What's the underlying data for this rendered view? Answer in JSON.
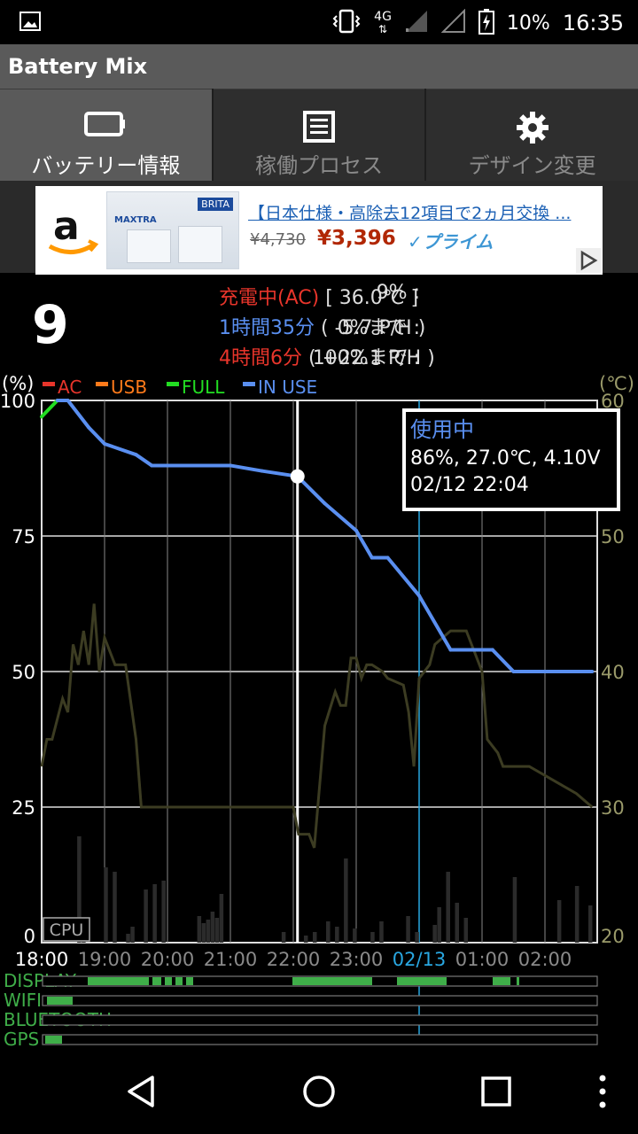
{
  "status_bar": {
    "battery_percent": "10%",
    "time": "16:35",
    "network": "4G",
    "icons": [
      "image-icon",
      "vibrate-icon",
      "signal-icon",
      "battery-charging-icon"
    ]
  },
  "app": {
    "title": "Battery Mix"
  },
  "tabs": [
    {
      "label": "バッテリー情報",
      "icon": "battery-icon",
      "active": true
    },
    {
      "label": "稼働プロセス",
      "icon": "list-icon",
      "active": false
    },
    {
      "label": "デザイン変更",
      "icon": "gear-icon",
      "active": false
    }
  ],
  "ad": {
    "title": "【日本仕様・高除去12項目で2ヵ月交換 ...",
    "price_old": "¥4,730",
    "price": "¥3,396",
    "prime": "✓プライム",
    "product_brand": "BRITA",
    "product_name": "MAXTRA"
  },
  "battery": {
    "level_big": "9",
    "line1": {
      "label": "9% : ",
      "value": "充電中(AC)",
      "extra": " [ 36.0℃ ]"
    },
    "line2": {
      "label": "0%まで : ",
      "value": "1時間35分",
      "extra": " ( -5.7 P/H )"
    },
    "line3": {
      "label": "100%まで : ",
      "value": "4時間6分",
      "extra": " ( +22.1 P/H )"
    }
  },
  "chart_data": {
    "type": "line",
    "left_axis_label": "(%)",
    "right_axis_label": "(℃)",
    "y_ticks_left": [
      "100",
      "75",
      "50",
      "25",
      "0"
    ],
    "y_ticks_right": [
      "60",
      "50",
      "40",
      "30",
      "20"
    ],
    "x_ticks": [
      "18:00",
      "19:00",
      "20:00",
      "21:00",
      "22:00",
      "23:00",
      "02/13",
      "01:00",
      "02:00"
    ],
    "legend": [
      {
        "name": "AC",
        "color": "#e8352b"
      },
      {
        "name": "USB",
        "color": "#ff7a1a"
      },
      {
        "name": "FULL",
        "color": "#22dd22"
      },
      {
        "name": "IN USE",
        "color": "#5a8ff0"
      }
    ],
    "cpu_label": "CPU",
    "tooltip": {
      "title": "使用中",
      "line1": "86%, 27.0℃, 4.10V",
      "line2": "02/12 22:04"
    },
    "battery_series": [
      {
        "t": "18:00",
        "v": 97,
        "state": "AC"
      },
      {
        "t": "18:15",
        "v": 100,
        "state": "FULL"
      },
      {
        "t": "18:25",
        "v": 100,
        "state": "IN USE"
      },
      {
        "t": "18:45",
        "v": 95,
        "state": "IN USE"
      },
      {
        "t": "19:00",
        "v": 92,
        "state": "IN USE"
      },
      {
        "t": "19:30",
        "v": 90,
        "state": "IN USE"
      },
      {
        "t": "19:45",
        "v": 88,
        "state": "IN USE"
      },
      {
        "t": "21:00",
        "v": 88,
        "state": "IN USE"
      },
      {
        "t": "21:30",
        "v": 87,
        "state": "IN USE"
      },
      {
        "t": "22:04",
        "v": 86,
        "state": "IN USE"
      },
      {
        "t": "22:30",
        "v": 81,
        "state": "IN USE"
      },
      {
        "t": "23:00",
        "v": 76,
        "state": "IN USE"
      },
      {
        "t": "23:15",
        "v": 71,
        "state": "IN USE"
      },
      {
        "t": "23:30",
        "v": 71,
        "state": "IN USE"
      },
      {
        "t": "00:00",
        "v": 64,
        "state": "IN USE"
      },
      {
        "t": "00:30",
        "v": 54,
        "state": "IN USE"
      },
      {
        "t": "01:10",
        "v": 54,
        "state": "IN USE"
      },
      {
        "t": "01:30",
        "v": 50,
        "state": "IN USE"
      },
      {
        "t": "02:45",
        "v": 50,
        "state": "IN USE"
      }
    ],
    "temperature_series": [
      {
        "t": "18:00",
        "c": 33
      },
      {
        "t": "18:05",
        "c": 35
      },
      {
        "t": "18:10",
        "c": 35
      },
      {
        "t": "18:15",
        "c": 36.5
      },
      {
        "t": "18:20",
        "c": 38
      },
      {
        "t": "18:25",
        "c": 37
      },
      {
        "t": "18:30",
        "c": 42
      },
      {
        "t": "18:35",
        "c": 40.5
      },
      {
        "t": "18:40",
        "c": 43
      },
      {
        "t": "18:45",
        "c": 40.5
      },
      {
        "t": "18:50",
        "c": 45
      },
      {
        "t": "18:55",
        "c": 40
      },
      {
        "t": "19:00",
        "c": 42.5
      },
      {
        "t": "19:10",
        "c": 40.5
      },
      {
        "t": "19:20",
        "c": 40.5
      },
      {
        "t": "19:30",
        "c": 35
      },
      {
        "t": "19:35",
        "c": 30
      },
      {
        "t": "22:00",
        "c": 30
      },
      {
        "t": "22:05",
        "c": 28
      },
      {
        "t": "22:15",
        "c": 28
      },
      {
        "t": "22:20",
        "c": 27
      },
      {
        "t": "22:30",
        "c": 36
      },
      {
        "t": "22:40",
        "c": 38.5
      },
      {
        "t": "22:45",
        "c": 37.5
      },
      {
        "t": "22:50",
        "c": 37.5
      },
      {
        "t": "22:55",
        "c": 41
      },
      {
        "t": "23:00",
        "c": 41
      },
      {
        "t": "23:05",
        "c": 39.5
      },
      {
        "t": "23:10",
        "c": 40.5
      },
      {
        "t": "23:15",
        "c": 40.5
      },
      {
        "t": "23:25",
        "c": 40
      },
      {
        "t": "23:30",
        "c": 39.5
      },
      {
        "t": "23:45",
        "c": 39
      },
      {
        "t": "23:50",
        "c": 37
      },
      {
        "t": "23:55",
        "c": 33
      },
      {
        "t": "00:00",
        "c": 39.5
      },
      {
        "t": "00:10",
        "c": 40.5
      },
      {
        "t": "00:15",
        "c": 42
      },
      {
        "t": "00:30",
        "c": 43
      },
      {
        "t": "00:45",
        "c": 43
      },
      {
        "t": "01:00",
        "c": 40
      },
      {
        "t": "01:05",
        "c": 35
      },
      {
        "t": "01:15",
        "c": 34
      },
      {
        "t": "01:20",
        "c": 33
      },
      {
        "t": "01:45",
        "c": 33
      },
      {
        "t": "02:30",
        "c": 31
      },
      {
        "t": "02:45",
        "c": 30
      }
    ],
    "tracks": [
      {
        "name": "DISPLAY",
        "color": "#3fae49"
      },
      {
        "name": "WIFI",
        "color": "#3fae49"
      },
      {
        "name": "BLUETOOTH",
        "color": "#3fae49"
      },
      {
        "name": "GPS",
        "color": "#3fae49"
      }
    ]
  }
}
